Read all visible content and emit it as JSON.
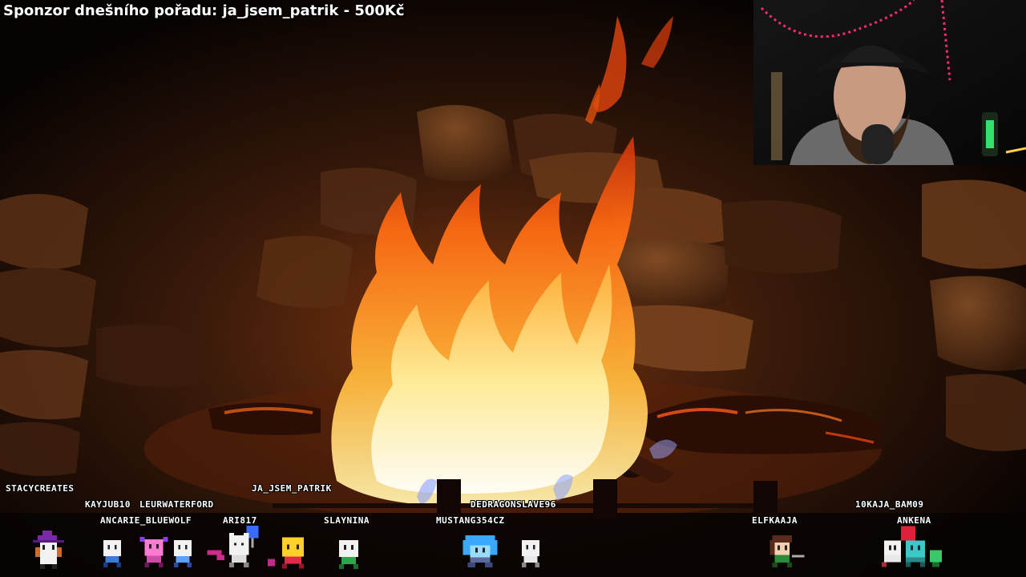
{
  "overlay": {
    "sponsor_text": "Sponzor dnešního pořadu: ja_jsem_patrik - 500Kč"
  },
  "chatters": [
    {
      "name": "STACYCREATES"
    },
    {
      "name": "KAYJUB10"
    },
    {
      "name": "LEURWATERFORD"
    },
    {
      "name": "ANCARIE_BLUEWOLF"
    },
    {
      "name": "ARI817"
    },
    {
      "name": "JA_JSEM_PATRIK"
    },
    {
      "name": "SLAYNINA"
    },
    {
      "name": "MUSTANG354CZ"
    },
    {
      "name": "DEDRAGONSLAVE96"
    },
    {
      "name": "ELFKAAJA"
    },
    {
      "name": "10KAJA_BAM09"
    },
    {
      "name": "ANKENA"
    }
  ],
  "colors": {
    "fire_core": "#ffe08a",
    "fire_mid": "#ff8a1e",
    "fire_outer": "#d8380a",
    "stone": "#6b3a1e",
    "led_strip": "#ff2a6a"
  }
}
